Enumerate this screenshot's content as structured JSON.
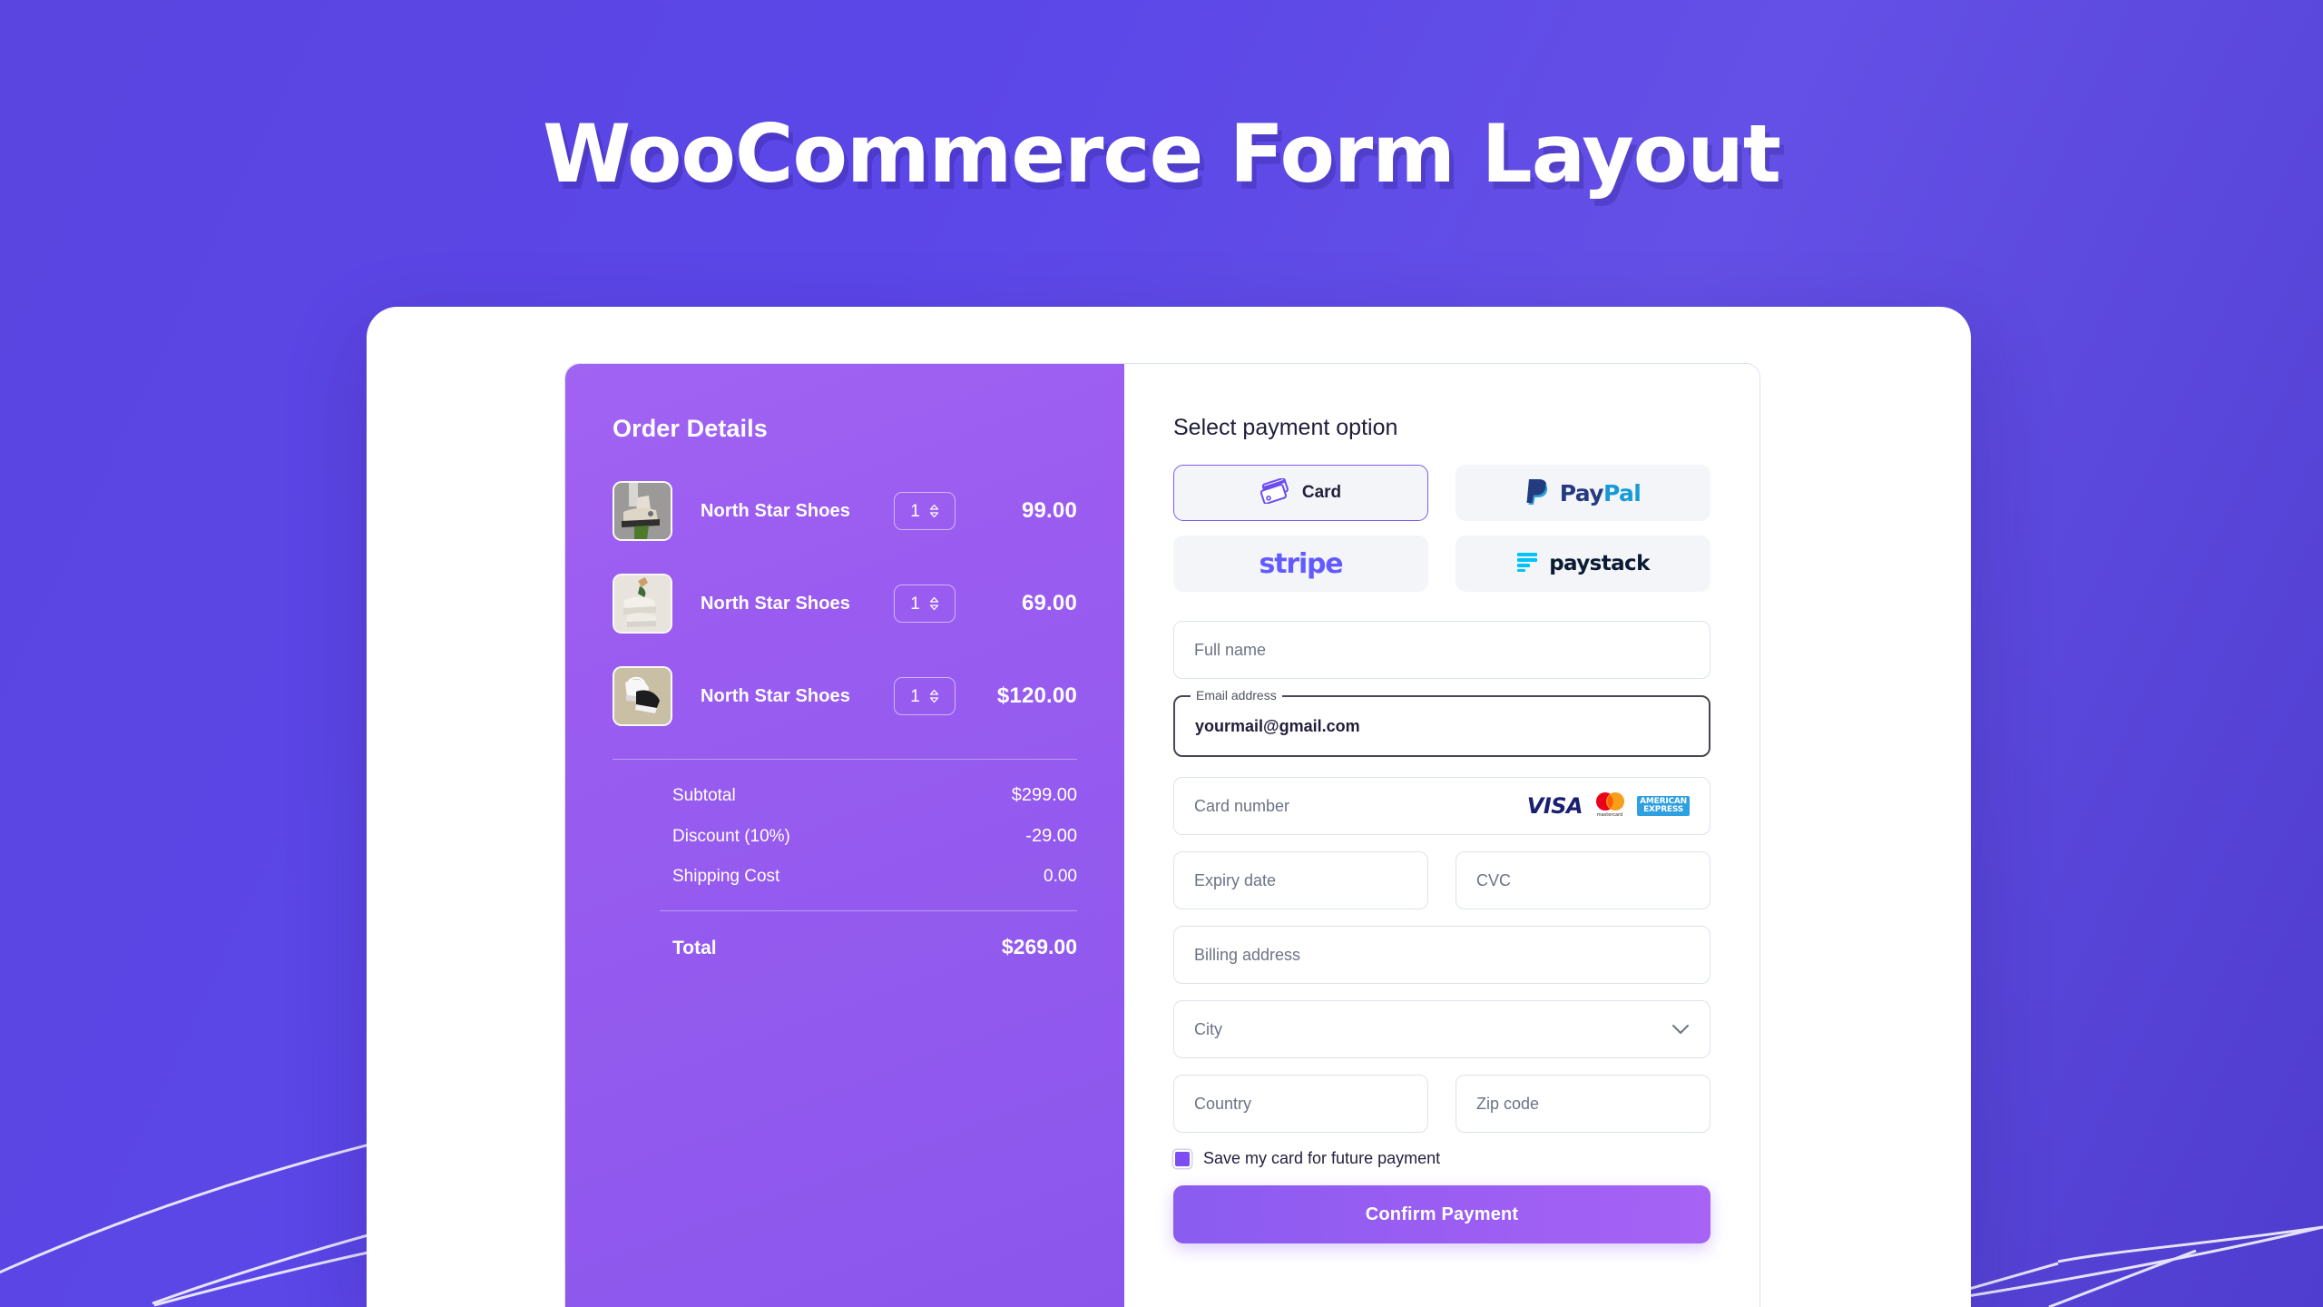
{
  "hero": {
    "title": "WooCommerce Form Layout"
  },
  "order": {
    "title": "Order Details",
    "items": [
      {
        "name": "North Star Shoes",
        "qty": "1",
        "price": "99.00",
        "thumb": "sneaker-side-photo"
      },
      {
        "name": "North Star Shoes",
        "qty": "1",
        "price": "69.00",
        "thumb": "sneaker-flatlay-photo"
      },
      {
        "name": "North Star Shoes",
        "qty": "1",
        "price": "$120.00",
        "thumb": "sneaker-pair-photo"
      }
    ],
    "summary": [
      {
        "label": "Subtotal",
        "value": "$299.00"
      },
      {
        "label": "Discount (10%)",
        "value": "-29.00"
      },
      {
        "label": "Shipping Cost",
        "value": "0.00"
      }
    ],
    "total": {
      "label": "Total",
      "value": "$269.00"
    }
  },
  "form": {
    "heading": "Select payment option",
    "payment_options": [
      {
        "id": "card",
        "label": "Card",
        "selected": true
      },
      {
        "id": "paypal",
        "label": "PayPal",
        "selected": false
      },
      {
        "id": "stripe",
        "label": "stripe",
        "selected": false
      },
      {
        "id": "paystack",
        "label": "paystack",
        "selected": false
      }
    ],
    "fields": {
      "full_name": {
        "placeholder": "Full name",
        "value": ""
      },
      "email": {
        "label": "Email address",
        "value": "yourmail@gmail.com"
      },
      "card_number": {
        "placeholder": "Card number",
        "value": ""
      },
      "expiry": {
        "placeholder": "Expiry date",
        "value": ""
      },
      "cvc": {
        "placeholder": "CVC",
        "value": ""
      },
      "billing_address": {
        "placeholder": "Billing address",
        "value": ""
      },
      "city": {
        "placeholder": "City",
        "value": ""
      },
      "country": {
        "placeholder": "Country",
        "value": ""
      },
      "zip": {
        "placeholder": "Zip code",
        "value": ""
      }
    },
    "card_brands": [
      "VISA",
      "mastercard",
      "AMERICAN EXPRESS"
    ],
    "amex_line1": "AMERICAN",
    "amex_line2": "EXPRESS",
    "mastercard_label": "mastercard",
    "save_card": {
      "label": "Save my card for future payment",
      "checked": true
    },
    "submit_label": "Confirm Payment"
  },
  "colors": {
    "background": "#5b45e0",
    "order_panel": "#9a5cf0",
    "accent": "#7c5cf0",
    "button": "#9a5df2",
    "stripe": "#635bff",
    "paypal_dark": "#253b80",
    "paypal_light": "#179bd7",
    "paystack_cyan": "#00c3f7",
    "visa": "#1a1f71",
    "amex": "#2e9fe0"
  }
}
